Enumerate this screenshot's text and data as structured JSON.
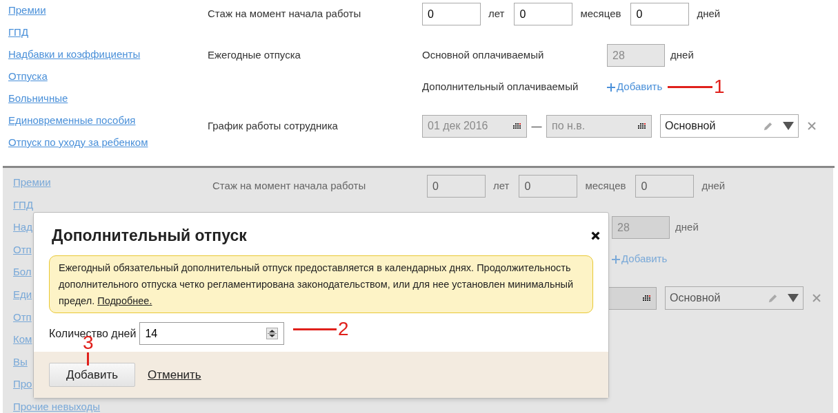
{
  "top_panel": {
    "sidebar": [
      "Премии",
      "ГПД",
      "Надбавки и коэффициенты",
      "Отпуска",
      "Больничные",
      "Единовременные пособия",
      "Отпуск по уходу за ребенком"
    ],
    "experience": {
      "label": "Стаж на момент начала работы",
      "fields": [
        {
          "value": "0",
          "unit": "лет"
        },
        {
          "value": "0",
          "unit": "месяцев"
        },
        {
          "value": "0",
          "unit": "дней"
        }
      ]
    },
    "vacations": {
      "label": "Ежегодные отпуска",
      "main": {
        "label": "Основной оплачиваемый",
        "value": "28",
        "unit": "дней",
        "disabled": true
      },
      "additional": {
        "label": "Дополнительный оплачиваемый",
        "add_link": "Добавить"
      }
    },
    "schedule": {
      "label": "График работы сотрудника",
      "date_from": {
        "value": "01 дек 2016",
        "disabled": true
      },
      "separator": "—",
      "date_to": {
        "value": "по н.в.",
        "disabled": true
      },
      "select": "Основной"
    }
  },
  "bottom_panel": {
    "sidebar": [
      "Премии",
      "ГПД",
      "Над",
      "Отп",
      "Бол",
      "Еди",
      "Отп",
      "Ком",
      "Вы",
      "Про",
      "Прочие невыходы"
    ],
    "experience": {
      "label": "Стаж на момент начала работы",
      "fields": [
        {
          "value": "0",
          "unit": "лет"
        },
        {
          "value": "0",
          "unit": "месяцев"
        },
        {
          "value": "0",
          "unit": "дней"
        }
      ]
    },
    "vacations": {
      "main": {
        "value": "28",
        "unit": "дней",
        "disabled": true
      },
      "additional": {
        "add_link": "Добавить"
      }
    },
    "schedule": {
      "date_to": {
        "disabled": true
      },
      "select": "Основной"
    }
  },
  "dialog": {
    "title": "Дополнительный отпуск",
    "notice": {
      "text": "Ежегодный обязательный дополнительный отпуск предоставляется в календарных днях. Продолжительность дополнительного отпуска четко регламентирована законодательством, или для нее установлен минимальный предел.",
      "link": "Подробнее."
    },
    "days": {
      "label": "Количество дней",
      "value": "14"
    },
    "buttons": {
      "primary": "Добавить",
      "cancel": "Отменить"
    }
  },
  "annotations": [
    {
      "label": "1"
    },
    {
      "label": "2"
    },
    {
      "label": "3"
    }
  ]
}
